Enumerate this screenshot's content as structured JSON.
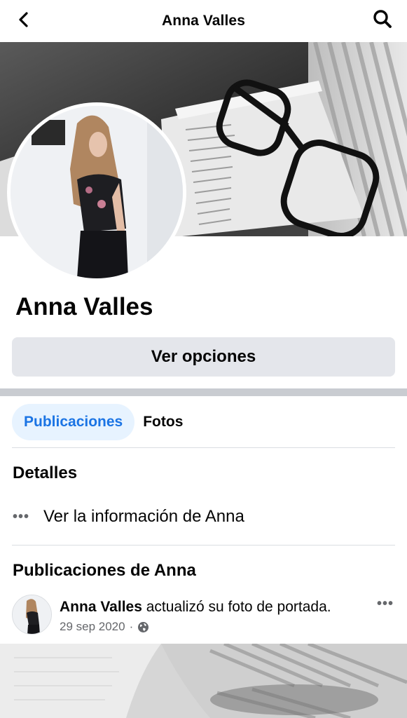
{
  "header": {
    "title": "Anna Valles",
    "back_icon": "chevron-left-icon",
    "search_icon": "search-icon"
  },
  "profile": {
    "name": "Anna Valles",
    "options_button": "Ver opciones"
  },
  "tabs": [
    {
      "label": "Publicaciones",
      "active": true
    },
    {
      "label": "Fotos",
      "active": false
    }
  ],
  "details": {
    "heading": "Detalles",
    "info_link": "Ver la información de Anna"
  },
  "posts": {
    "heading": "Publicaciones de Anna",
    "items": [
      {
        "author": "Anna Valles",
        "action": "actualizó su foto de portada.",
        "date": "29 sep 2020",
        "separator": "·",
        "audience_icon": "globe-icon"
      }
    ]
  },
  "colors": {
    "accent": "#1b74e4",
    "accent_bg": "#e7f3ff",
    "button_bg": "#e4e6eb",
    "secondary_text": "#65676b"
  }
}
